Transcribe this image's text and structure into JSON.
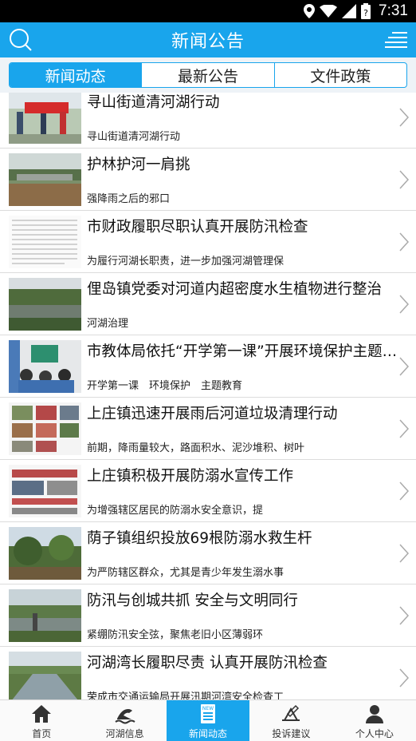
{
  "status_bar": {
    "time": "7:31"
  },
  "header": {
    "title": "新闻公告",
    "search_icon": "search-icon",
    "menu_icon": "menu-icon"
  },
  "tabs": [
    {
      "label": "新闻动态",
      "active": true
    },
    {
      "label": "最新公告",
      "active": false
    },
    {
      "label": "文件政策",
      "active": false
    }
  ],
  "news": [
    {
      "title": "寻山街道清河湖行动",
      "summary": "寻山街道清河湖行动"
    },
    {
      "title": "护林护河一肩挑",
      "summary": "强降雨之后的邪口"
    },
    {
      "title": "市财政履职尽职认真开展防汛检查",
      "summary": "为履行河湖长职责，进一步加强河湖管理保"
    },
    {
      "title": "俚岛镇党委对河道内超密度水生植物进行整治",
      "summary": "河湖治理"
    },
    {
      "title": "市教体局依托“开学第一课”开展环境保护主题教育",
      "summary": "开学第一课　环境保护　主题教育"
    },
    {
      "title": "上庄镇迅速开展雨后河道垃圾清理行动",
      "summary": "前期，降雨量较大，路面积水、泥沙堆积、树叶"
    },
    {
      "title": "上庄镇积极开展防溺水宣传工作",
      "summary": "为增强辖区居民的防溺水安全意识，提"
    },
    {
      "title": "荫子镇组织投放69根防溺水救生杆",
      "summary": "为严防辖区群众，尤其是青少年发生溺水事"
    },
    {
      "title": "防汛与创城共抓 安全与文明同行",
      "summary": "紧绷防汛安全弦，聚焦老旧小区薄弱环"
    },
    {
      "title": "河湖湾长履职尽责 认真开展防汛检查",
      "summary": "荣成市交通运输局开展汛期河湾安全检查工"
    }
  ],
  "bottom_nav": [
    {
      "label": "首页",
      "icon": "home-icon",
      "active": false
    },
    {
      "label": "河湖信息",
      "icon": "river-info-icon",
      "active": false
    },
    {
      "label": "新闻动态",
      "icon": "news-icon",
      "active": true
    },
    {
      "label": "投诉建议",
      "icon": "complaint-icon",
      "active": false
    },
    {
      "label": "个人中心",
      "icon": "person-icon",
      "active": false
    }
  ],
  "colors": {
    "accent": "#19a5ec",
    "statusbar": "#000000"
  }
}
